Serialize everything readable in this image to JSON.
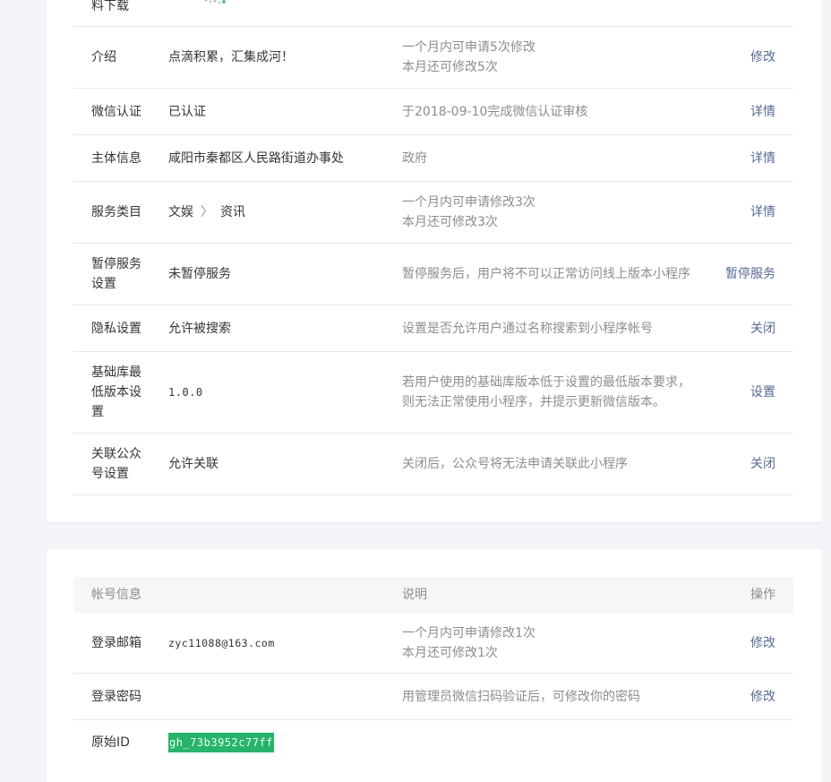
{
  "basic": {
    "rows": [
      {
        "name": "料下载",
        "value": "",
        "desc": [],
        "action": ""
      },
      {
        "name": "介绍",
        "value": "点滴积累，汇集成河！",
        "desc": [
          "一个月内可申请5次修改",
          "本月还可修改5次"
        ],
        "action": "修改"
      },
      {
        "name": "微信认证",
        "value": "已认证",
        "desc": [
          "于2018-09-10完成微信认证审核"
        ],
        "action": "详情"
      },
      {
        "name": "主体信息",
        "value": "咸阳市秦都区人民路街道办事处",
        "desc": [
          "政府"
        ],
        "action": "详情"
      },
      {
        "name": "服务类目",
        "value_parts": [
          "文娱",
          "资讯"
        ],
        "desc": [
          "一个月内可申请修改3次",
          "本月还可修改3次"
        ],
        "action": "详情"
      },
      {
        "name_lines": [
          "暂停服务",
          "设置"
        ],
        "value": "未暂停服务",
        "desc": [
          "暂停服务后，用户将不可以正常访问线上版本小程序"
        ],
        "action": "暂停服务"
      },
      {
        "name": "隐私设置",
        "value": "允许被搜索",
        "desc": [
          "设置是否允许用户通过名称搜索到小程序帐号"
        ],
        "action": "关闭"
      },
      {
        "name_lines": [
          "基础库最",
          "低版本设",
          "置"
        ],
        "value": "1.0.0",
        "desc": [
          "若用户使用的基础库版本低于设置的最低版本要求，",
          "则无法正常使用小程序，并提示更新微信版本。"
        ],
        "action": "设置"
      },
      {
        "name_lines": [
          "关联公众",
          "号设置"
        ],
        "value": "允许关联",
        "desc": [
          "关闭后，公众号将无法申请关联此小程序"
        ],
        "action": "关闭"
      }
    ]
  },
  "account": {
    "header": {
      "name": "帐号信息",
      "desc": "说明",
      "action": "操作"
    },
    "rows": [
      {
        "name": "登录邮箱",
        "value": "zyc11088@163.com",
        "desc": [
          "一个月内可申请修改1次",
          "本月还可修改1次"
        ],
        "action": "修改"
      },
      {
        "name": "登录密码",
        "value": "",
        "desc": [
          "用管理员微信扫码验证后，可修改你的密码"
        ],
        "action": "修改"
      },
      {
        "name": "原始ID",
        "value": "gh_73b3952c77ff",
        "desc": [],
        "action": ""
      }
    ]
  }
}
